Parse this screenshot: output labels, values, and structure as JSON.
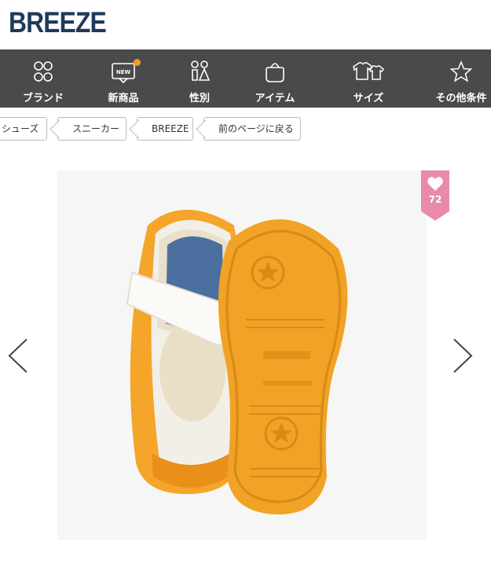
{
  "header": {
    "logo_text": "BREEZE"
  },
  "nav": {
    "items": [
      {
        "label": "ブランド",
        "icon": "brand-icon"
      },
      {
        "label": "新商品",
        "icon": "new-icon",
        "badge_text": "NEW"
      },
      {
        "label": "性別",
        "icon": "gender-icon"
      },
      {
        "label": "アイテム",
        "icon": "bag-icon"
      },
      {
        "label": "サイズ",
        "icon": "size-icon"
      },
      {
        "label": "その他条件",
        "icon": "star-icon"
      }
    ]
  },
  "breadcrumb": {
    "items": [
      {
        "label": "シューズ"
      },
      {
        "label": "スニーカー"
      },
      {
        "label": "BREEZE"
      },
      {
        "label": "前のページに戻る"
      }
    ]
  },
  "product": {
    "image": "product-photo",
    "favorite_count": "72"
  },
  "colors": {
    "brand": "#1f3a5a",
    "nav_bg": "#4a4a4a",
    "accent_orange": "#f39a1e",
    "favorite_pink": "#e88aa8"
  }
}
